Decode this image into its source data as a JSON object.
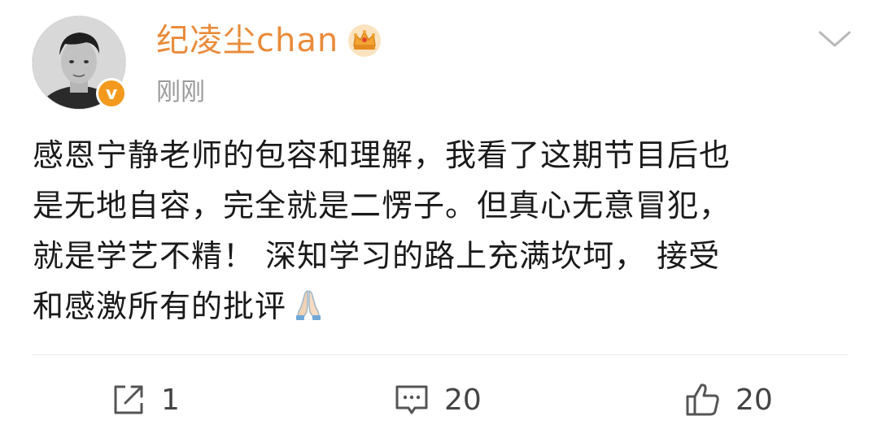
{
  "author": {
    "name": "纪凌尘chan",
    "badge_icon": "crown-icon",
    "verified_icon": "verified-v-icon",
    "avatar": "avatar-photo"
  },
  "post": {
    "timestamp": "刚刚",
    "lines": [
      "感恩宁静老师的包容和理解，我看了这期节目后也",
      "是无地自容，完全就是二愣子。但真心无意冒犯，",
      "就是学艺不精！ 深知学习的路上充满坎坷， 接受",
      "和感激所有的批评"
    ],
    "trailing_emoji": "praying-hands-icon"
  },
  "actions": {
    "repost_count": "1",
    "comment_count": "20",
    "like_count": "20"
  },
  "colors": {
    "username": "#e98b3a",
    "verified_badge": "#f39a1e",
    "timestamp": "#9a9a9a",
    "text": "#1a1a1a",
    "action": "#444444"
  }
}
